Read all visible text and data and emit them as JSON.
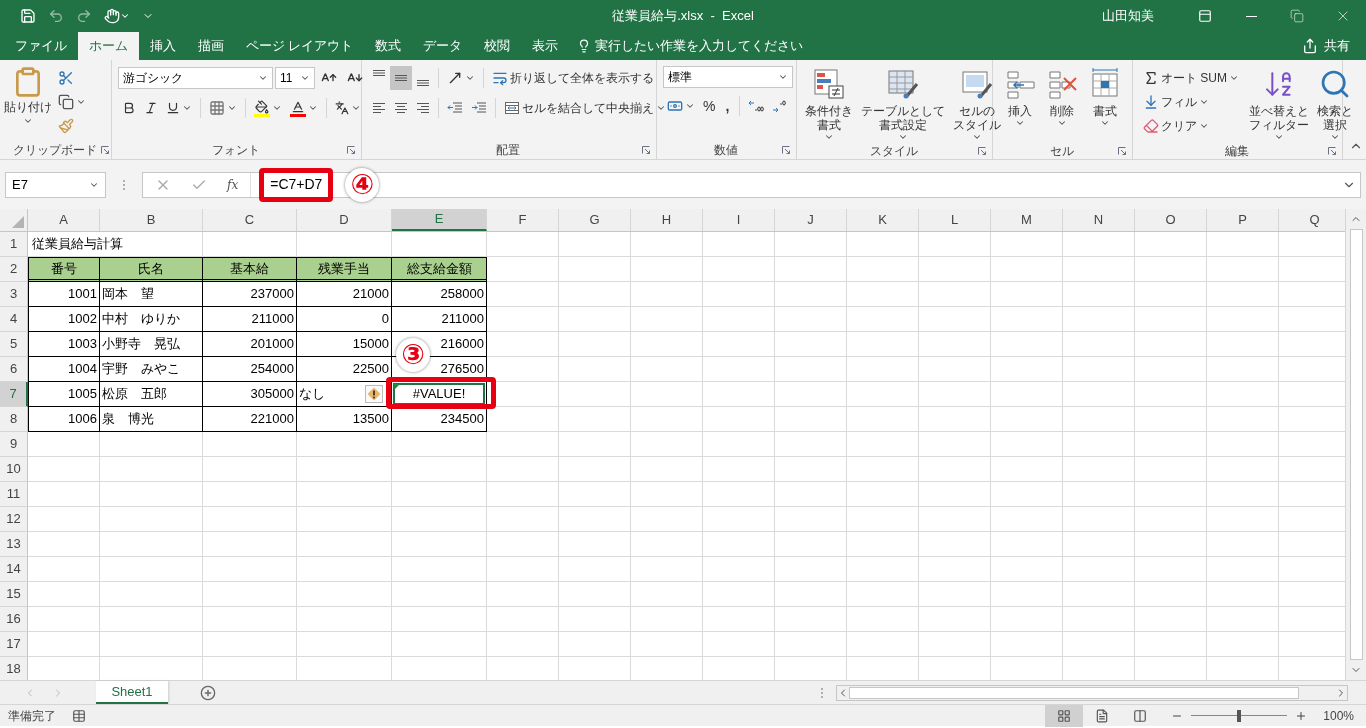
{
  "title_bar": {
    "file_title": "従業員給与.xlsx  -  Excel",
    "user": "山田知美"
  },
  "ribbon_tabs": [
    {
      "label": "ファイル",
      "selected": false
    },
    {
      "label": "ホーム",
      "selected": true
    },
    {
      "label": "挿入",
      "selected": false
    },
    {
      "label": "描画",
      "selected": false
    },
    {
      "label": "ページ レイアウト",
      "selected": false
    },
    {
      "label": "数式",
      "selected": false
    },
    {
      "label": "データ",
      "selected": false
    },
    {
      "label": "校閲",
      "selected": false
    },
    {
      "label": "表示",
      "selected": false
    }
  ],
  "tell_me": {
    "placeholder": "実行したい作業を入力してください"
  },
  "share": "共有",
  "clipboard": {
    "paste": "貼り付け",
    "label": "クリップボード"
  },
  "font": {
    "name": "游ゴシック",
    "size": "11",
    "label": "フォント"
  },
  "alignment": {
    "vertical": [
      {
        "kind": "top",
        "selected": false
      },
      {
        "kind": "middle",
        "selected": true
      },
      {
        "kind": "bottom",
        "selected": false
      }
    ],
    "wrap": "折り返して全体を表示する",
    "merge": "セルを結合して中央揃え",
    "label": "配置"
  },
  "number": {
    "format": "標準",
    "percent": "%",
    "comma": ",",
    "label": "数値"
  },
  "styles": {
    "buttons": [
      {
        "kind": "conditional",
        "lines": [
          "条件付き",
          "書式"
        ]
      },
      {
        "kind": "table",
        "lines": [
          "テーブルとして",
          "書式設定"
        ]
      },
      {
        "kind": "cell_style",
        "lines": [
          "セルの",
          "スタイル"
        ]
      }
    ],
    "label": "スタイル"
  },
  "cells": {
    "buttons": [
      {
        "kind": "insert",
        "lines": [
          "挿入"
        ]
      },
      {
        "kind": "delete",
        "lines": [
          "削除"
        ]
      },
      {
        "kind": "format",
        "lines": [
          "書式"
        ]
      }
    ],
    "label": "セル"
  },
  "editing": {
    "small": [
      {
        "kind": "sum",
        "label": "オート SUM"
      },
      {
        "kind": "fill",
        "label": "フィル"
      },
      {
        "kind": "clear",
        "label": "クリア"
      }
    ],
    "large": [
      {
        "kind": "sort",
        "lines": [
          "並べ替えと",
          "フィルター"
        ]
      },
      {
        "kind": "find",
        "lines": [
          "検索と",
          "選択"
        ]
      }
    ],
    "label": "編集"
  },
  "formula_bar": {
    "name_box": "E7",
    "fx": "fx",
    "formula": "=C7+D7",
    "callout": "④"
  },
  "columns": [
    {
      "label": "A",
      "selected": false
    },
    {
      "label": "B",
      "selected": false
    },
    {
      "label": "C",
      "selected": false
    },
    {
      "label": "D",
      "selected": false
    },
    {
      "label": "E",
      "selected": true
    },
    {
      "label": "F",
      "selected": false
    },
    {
      "label": "G",
      "selected": false
    },
    {
      "label": "H",
      "selected": false
    },
    {
      "label": "I",
      "selected": false
    },
    {
      "label": "J",
      "selected": false
    },
    {
      "label": "K",
      "selected": false
    },
    {
      "label": "L",
      "selected": false
    },
    {
      "label": "M",
      "selected": false
    },
    {
      "label": "N",
      "selected": false
    },
    {
      "label": "O",
      "selected": false
    },
    {
      "label": "P",
      "selected": false
    },
    {
      "label": "Q",
      "selected": false
    }
  ],
  "row_headers": [
    {
      "label": "1",
      "selected": false
    },
    {
      "label": "2",
      "selected": false
    },
    {
      "label": "3",
      "selected": false
    },
    {
      "label": "4",
      "selected": false
    },
    {
      "label": "5",
      "selected": false
    },
    {
      "label": "6",
      "selected": false
    },
    {
      "label": "7",
      "selected": true
    },
    {
      "label": "8",
      "selected": false
    },
    {
      "label": "9",
      "selected": false
    },
    {
      "label": "10",
      "selected": false
    },
    {
      "label": "11",
      "selected": false
    },
    {
      "label": "12",
      "selected": false
    },
    {
      "label": "13",
      "selected": false
    },
    {
      "label": "14",
      "selected": false
    },
    {
      "label": "15",
      "selected": false
    },
    {
      "label": "16",
      "selected": false
    },
    {
      "label": "17",
      "selected": false
    },
    {
      "label": "18",
      "selected": false
    }
  ],
  "sheet": {
    "title": "従業員給与計算",
    "headers": [
      "番号",
      "氏名",
      "基本給",
      "残業手当",
      "総支給金額"
    ],
    "rows": [
      {
        "cells": [
          "1001",
          "岡本　望",
          "237000",
          "21000",
          "258000"
        ],
        "error": false
      },
      {
        "cells": [
          "1002",
          "中村　ゆりか",
          "211000",
          "0",
          "211000"
        ],
        "error": false
      },
      {
        "cells": [
          "1003",
          "小野寺　晃弘",
          "201000",
          "15000",
          "216000"
        ],
        "error": false
      },
      {
        "cells": [
          "1004",
          "宇野　みやこ",
          "254000",
          "22500",
          "276500"
        ],
        "error": false
      },
      {
        "cells": [
          "1005",
          "松原　五郎",
          "305000",
          "なし",
          "#VALUE!"
        ],
        "error": true
      },
      {
        "cells": [
          "1006",
          "泉　博光",
          "221000",
          "13500",
          "234500"
        ],
        "error": false
      }
    ]
  },
  "cell_callout": "③",
  "sheet_tabs": [
    {
      "label": "Sheet1",
      "selected": true
    }
  ],
  "status_bar": {
    "status": "準備完了",
    "views": [
      {
        "kind": "normal",
        "selected": true
      },
      {
        "kind": "page_layout",
        "selected": false
      },
      {
        "kind": "page_break",
        "selected": false
      }
    ],
    "zoom": {
      "level": 0.5,
      "reading": "100%"
    }
  }
}
